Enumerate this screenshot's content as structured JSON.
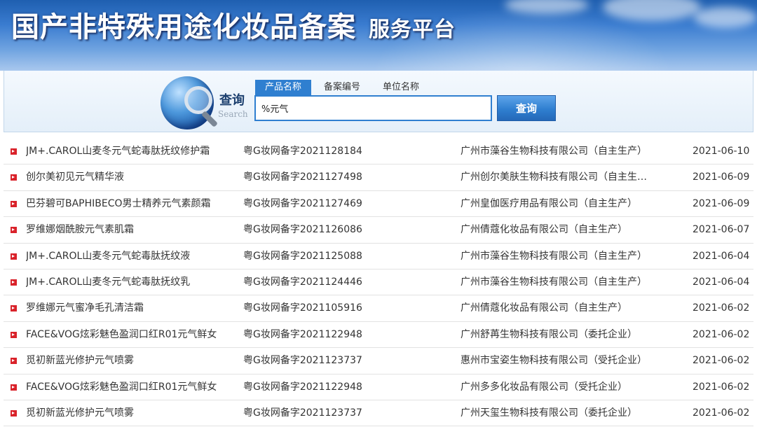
{
  "banner": {
    "title": "国产非特殊用途化妆品备案",
    "subtitle": "服务平台"
  },
  "search": {
    "logo_text_zh": "查询",
    "logo_text_en": "Search",
    "tabs": [
      {
        "label": "产品名称",
        "active": true
      },
      {
        "label": "备案编号",
        "active": false
      },
      {
        "label": "单位名称",
        "active": false
      }
    ],
    "query": "%元气",
    "button_label": "查询"
  },
  "colors": {
    "accent": "#2f7fd0",
    "bullet": "#d9222a",
    "banner": "#3a7cd0"
  },
  "results": [
    {
      "name": "JM+.CAROL山麦冬元气蛇毒肽抚纹修护霜",
      "record": "粤G妆网备字2021128184",
      "company": "广州市藻谷生物科技有限公司（自主生产）",
      "date": "2021-06-10"
    },
    {
      "name": "创尔美初见元气精华液",
      "record": "粤G妆网备字2021127498",
      "company": "广州创尔美肤生物科技有限公司（自主生…",
      "date": "2021-06-09"
    },
    {
      "name": "巴芬碧可BAPHIBECO男士精养元气素颜霜",
      "record": "粤G妆网备字2021127469",
      "company": "广州皇伽医疗用品有限公司（自主生产）",
      "date": "2021-06-09"
    },
    {
      "name": "罗维娜烟酰胺元气素肌霜",
      "record": "粤G妆网备字2021126086",
      "company": "广州倩蔻化妆品有限公司（自主生产）",
      "date": "2021-06-07"
    },
    {
      "name": "JM+.CAROL山麦冬元气蛇毒肽抚纹液",
      "record": "粤G妆网备字2021125088",
      "company": "广州市藻谷生物科技有限公司（自主生产）",
      "date": "2021-06-04"
    },
    {
      "name": "JM+.CAROL山麦冬元气蛇毒肽抚纹乳",
      "record": "粤G妆网备字2021124446",
      "company": "广州市藻谷生物科技有限公司（自主生产）",
      "date": "2021-06-04"
    },
    {
      "name": "罗维娜元气蜜净毛孔清洁霜",
      "record": "粤G妆网备字2021105916",
      "company": "广州倩蔻化妆品有限公司（自主生产）",
      "date": "2021-06-02"
    },
    {
      "name": "FACE&VOG炫彩魅色盈润口红R01元气鲜女",
      "record": "粤G妆网备字2021122948",
      "company": "广州舒苒生物科技有限公司（委托企业）",
      "date": "2021-06-02"
    },
    {
      "name": "觅初新蓝光修护元气喷雾",
      "record": "粤G妆网备字2021123737",
      "company": "惠州市宝姿生物科技有限公司（受托企业）",
      "date": "2021-06-02"
    },
    {
      "name": "FACE&VOG炫彩魅色盈润口红R01元气鲜女",
      "record": "粤G妆网备字2021122948",
      "company": "广州多多化妆品有限公司（受托企业）",
      "date": "2021-06-02"
    },
    {
      "name": "觅初新蓝光修护元气喷雾",
      "record": "粤G妆网备字2021123737",
      "company": "广州天玺生物科技有限公司（委托企业）",
      "date": "2021-06-02"
    }
  ]
}
